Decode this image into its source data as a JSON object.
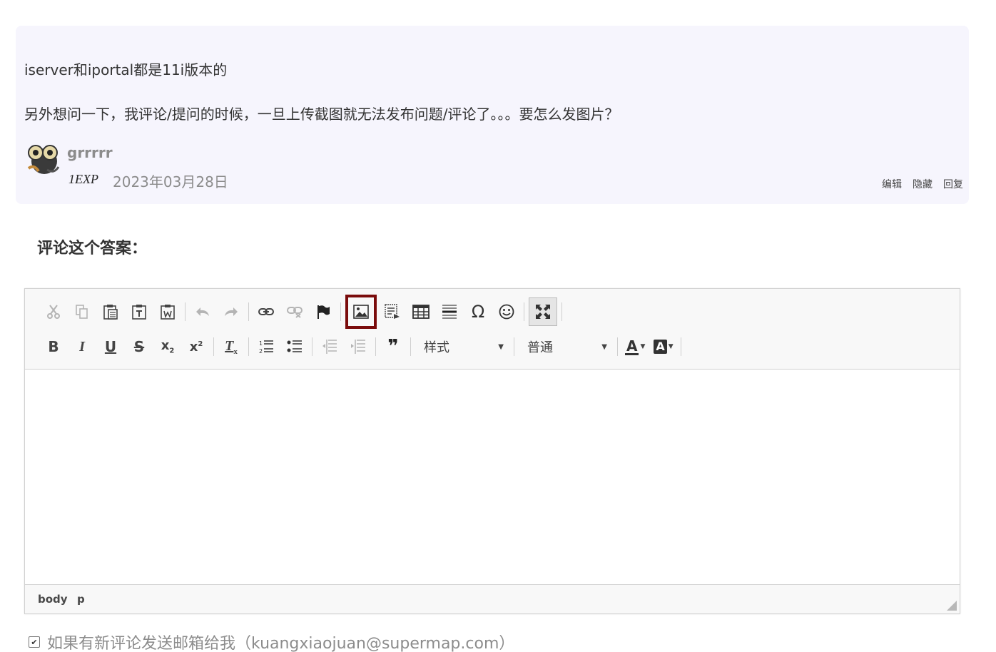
{
  "comment": {
    "text_line_1": "iserver和iportal都是11i版本的",
    "text_line_2": "另外想问一下，我评论/提问的时候，一旦上传截图就无法发布问题/评论了。。。要怎么发图片？",
    "username": "grrrrr",
    "exp": "1EXP",
    "date": "2023年03月28日",
    "actions": {
      "edit": "编辑",
      "hide": "隐藏",
      "reply": "回复"
    }
  },
  "section": {
    "heading": "评论这个答案："
  },
  "editor": {
    "toolbar": {
      "row1": [
        {
          "name": "cut",
          "icon": "cut-icon",
          "enabled": false
        },
        {
          "name": "copy",
          "icon": "copy-icon",
          "enabled": false
        },
        {
          "name": "paste",
          "icon": "paste-icon",
          "enabled": true
        },
        {
          "name": "paste-text",
          "icon": "paste-text-icon",
          "enabled": true
        },
        {
          "name": "paste-word",
          "icon": "paste-word-icon",
          "enabled": true
        },
        {
          "name": "undo",
          "icon": "undo-icon",
          "enabled": false
        },
        {
          "name": "redo",
          "icon": "redo-icon",
          "enabled": false
        },
        {
          "name": "link",
          "icon": "link-icon",
          "enabled": true
        },
        {
          "name": "unlink",
          "icon": "unlink-icon",
          "enabled": false
        },
        {
          "name": "anchor",
          "icon": "anchor-flag-icon",
          "enabled": true
        },
        {
          "name": "image",
          "icon": "image-icon",
          "enabled": true,
          "highlighted": true
        },
        {
          "name": "flash",
          "icon": "flash-icon",
          "enabled": true
        },
        {
          "name": "table",
          "icon": "table-icon",
          "enabled": true
        },
        {
          "name": "horizontal-rule",
          "icon": "horizontal-rule-icon",
          "enabled": true
        },
        {
          "name": "special-char",
          "icon": "omega-icon",
          "enabled": true
        },
        {
          "name": "smiley",
          "icon": "smiley-icon",
          "enabled": true
        },
        {
          "name": "maximize",
          "icon": "maximize-icon",
          "enabled": true,
          "active": true
        }
      ],
      "row2_glyphs": {
        "bold": "B",
        "italic": "I",
        "underline": "U",
        "strike": "S",
        "subscript": "x",
        "superscript": "x",
        "remove_format": "T",
        "blockquote": "❞"
      },
      "style_combo": {
        "label": "样式",
        "arrow": "▼"
      },
      "format_combo": {
        "label": "普通",
        "arrow": "▼"
      },
      "text_color": {
        "glyph": "A",
        "arrow": "▼",
        "color": "#333333"
      },
      "bg_color": {
        "glyph": "A",
        "arrow": "▼",
        "color": "#333333"
      }
    },
    "content": "",
    "elements_path": [
      "body",
      "p"
    ]
  },
  "subscribe": {
    "checked": true,
    "check_glyph": "✔",
    "label": "如果有新评论发送邮箱给我（kuangxiaojuan@supermap.com）"
  },
  "colors": {
    "card_bg": "#f6f5fd",
    "highlight_border": "#7a0c0c",
    "toolbar_bg": "#f8f8f8",
    "muted_text": "#8c8c8c"
  }
}
